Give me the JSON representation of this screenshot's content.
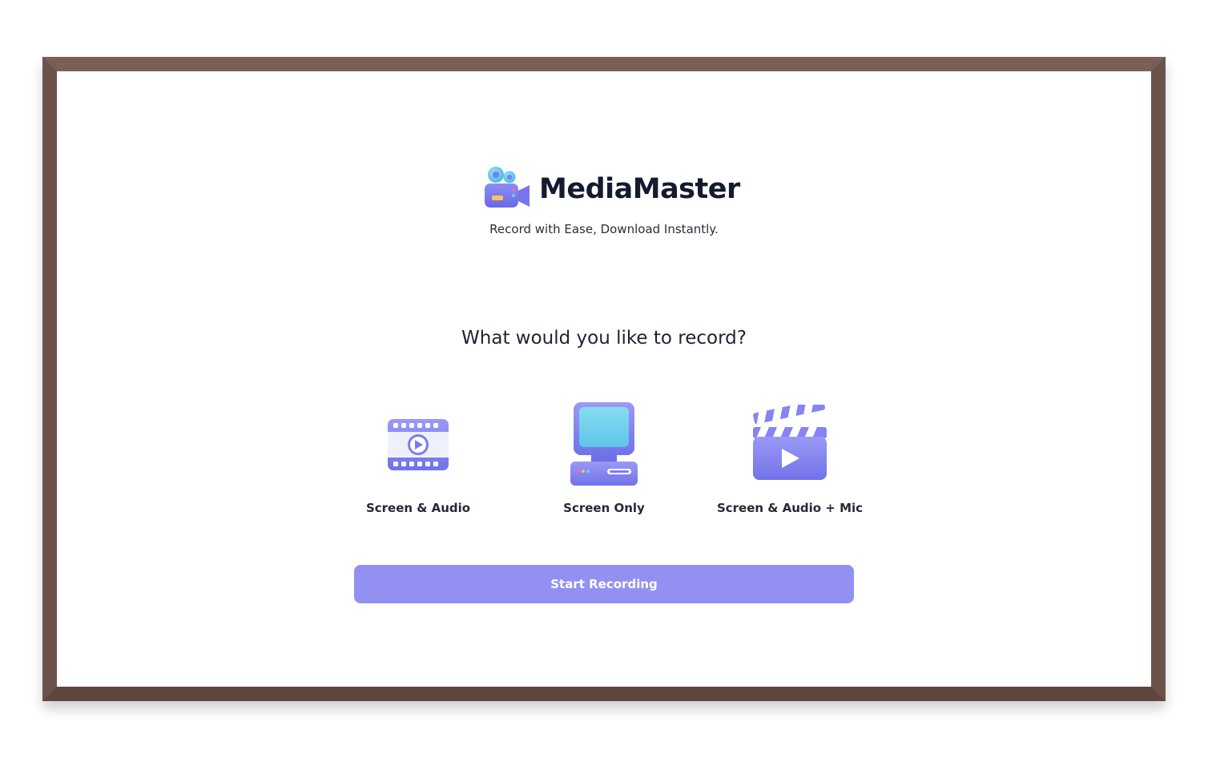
{
  "app": {
    "name": "MediaMaster",
    "tagline": "Record with Ease, Download Instantly.",
    "logo_icon": "video-camera-icon"
  },
  "prompt": {
    "question": "What would you like to record?"
  },
  "options": [
    {
      "label": "Screen & Audio",
      "icon": "film-strip-play-icon"
    },
    {
      "label": "Screen Only",
      "icon": "desktop-computer-icon"
    },
    {
      "label": "Screen & Audio + Mic",
      "icon": "clapperboard-play-icon"
    }
  ],
  "actions": {
    "start_label": "Start Recording"
  },
  "colors": {
    "accent": "#9291f2",
    "icon_purple": "#7f7ff0",
    "icon_cyan": "#6fd0ec",
    "frame": "#6b524a",
    "text_dark": "#151a2e"
  }
}
